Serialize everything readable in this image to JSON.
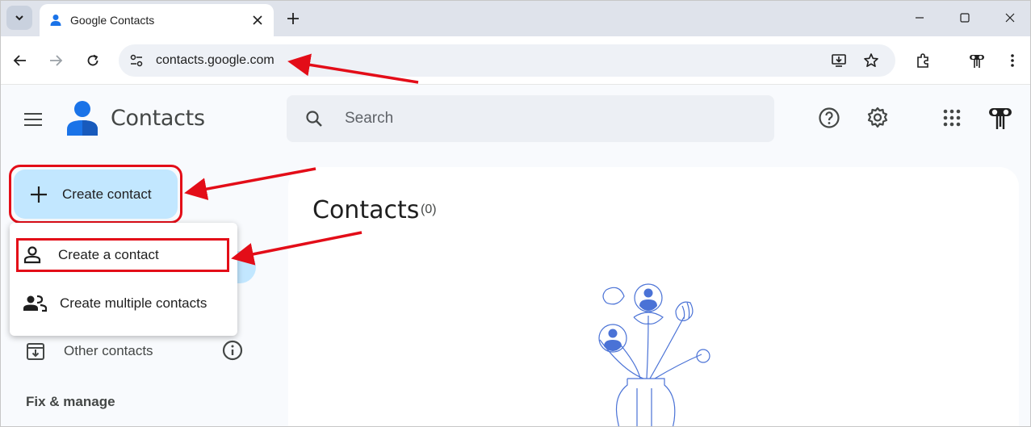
{
  "browser": {
    "tab_title": "Google Contacts",
    "new_tab_icon": "plus-icon",
    "url": "contacts.google.com",
    "window_controls": [
      "minimize-icon",
      "maximize-icon",
      "close-icon"
    ]
  },
  "app": {
    "title": "Contacts",
    "search_placeholder": "Search",
    "header_icons": [
      "help-icon",
      "settings-icon",
      "apps-grid-icon",
      "account-avatar"
    ]
  },
  "sidebar": {
    "create_button_label": "Create contact",
    "menu_items": [
      {
        "label": "Create a contact",
        "icon": "person-icon"
      },
      {
        "label": "Create multiple contacts",
        "icon": "people-icon"
      }
    ],
    "other_contacts_label": "Other contacts",
    "section_label": "Fix & manage"
  },
  "main": {
    "title": "Contacts",
    "count": "(0)"
  },
  "colors": {
    "accent_blue": "#0b57d0",
    "create_button_bg": "#c2e7ff",
    "annotation_red": "#e30d18",
    "illustration_blue": "#4a72d6"
  }
}
